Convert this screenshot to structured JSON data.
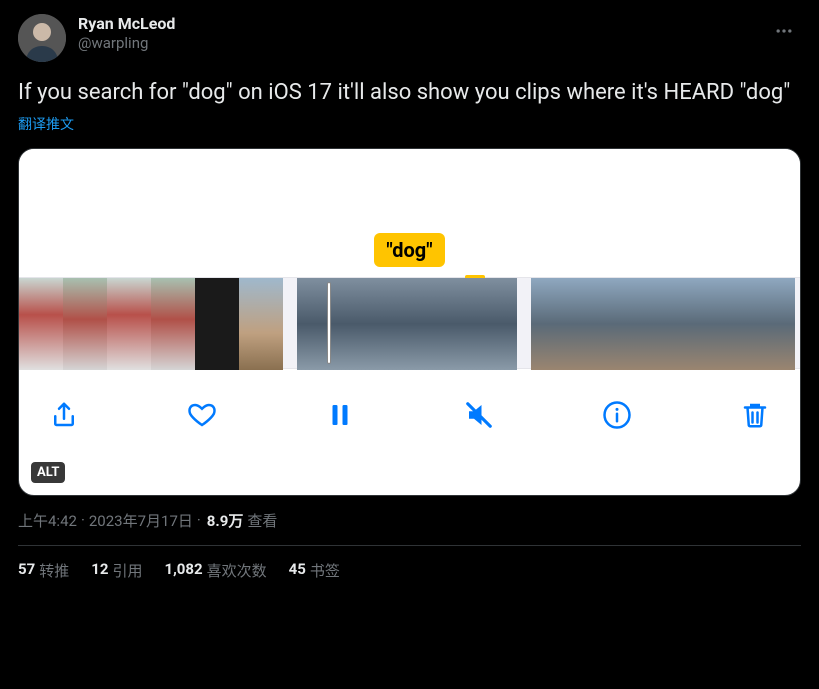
{
  "author": {
    "display_name": "Ryan McLeod",
    "handle": "@warpling"
  },
  "tweet_text": "If you search for \"dog\" on iOS 17 it'll also show you clips where it's HEARD \"dog\"",
  "translate_label": "翻译推文",
  "media": {
    "search_term": "\"dog\"",
    "alt_badge": "ALT"
  },
  "meta": {
    "time": "上午4:42",
    "date": "2023年7月17日",
    "separator": " · ",
    "views_count": "8.9万",
    "views_label": "查看"
  },
  "stats": {
    "retweets": {
      "count": "57",
      "label": "转推"
    },
    "quotes": {
      "count": "12",
      "label": "引用"
    },
    "likes": {
      "count": "1,082",
      "label": "喜欢次数"
    },
    "bookmarks": {
      "count": "45",
      "label": "书签"
    }
  }
}
